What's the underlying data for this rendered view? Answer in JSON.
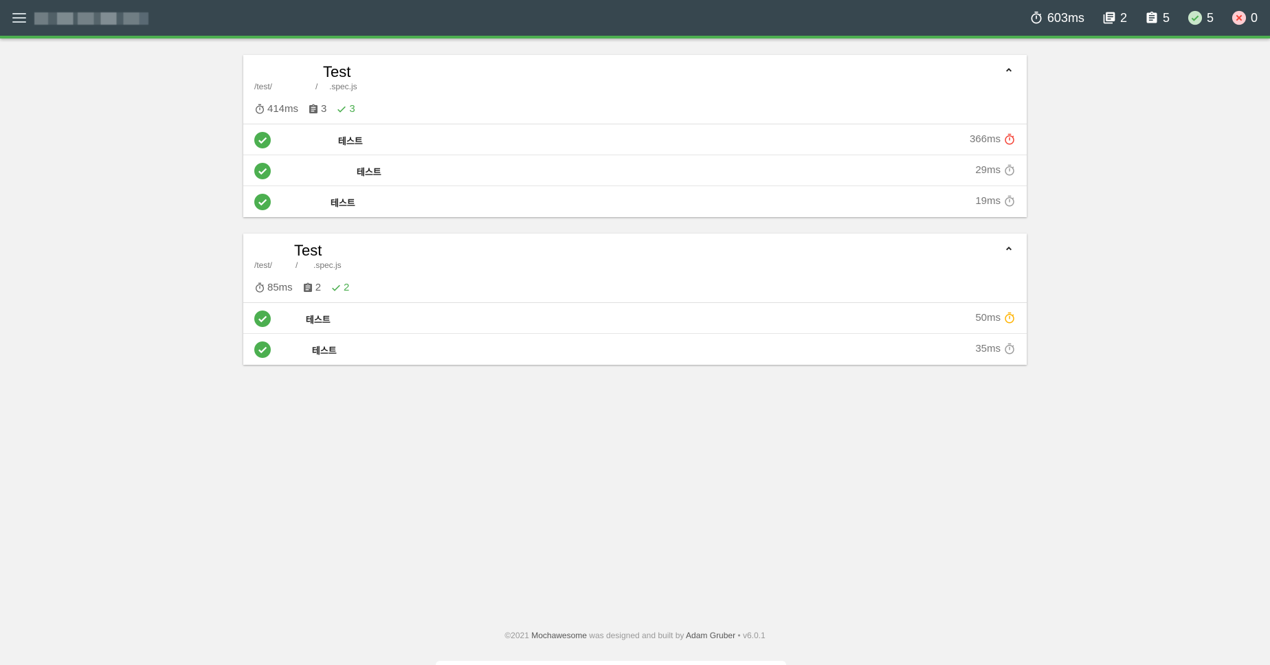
{
  "navbar": {
    "stats": {
      "duration": "603ms",
      "suites": "2",
      "tests": "5",
      "passes": "5",
      "failures": "0"
    }
  },
  "suites": [
    {
      "title": "Test",
      "path_prefix": "/test/",
      "path_sep": "/",
      "path_file": ".spec.js",
      "duration": "414ms",
      "tests_count": "3",
      "passes_count": "3",
      "tests": [
        {
          "title": "테스트",
          "duration": "366ms",
          "speed": "slow"
        },
        {
          "title": "테스트",
          "duration": "29ms",
          "speed": "fast"
        },
        {
          "title": "테스트",
          "duration": "19ms",
          "speed": "fast"
        }
      ]
    },
    {
      "title": "Test",
      "path_prefix": "/test/",
      "path_sep": "/",
      "path_file": ".spec.js",
      "duration": "85ms",
      "tests_count": "2",
      "passes_count": "2",
      "tests": [
        {
          "title": "테스트",
          "duration": "50ms",
          "speed": "medium"
        },
        {
          "title": "테스트",
          "duration": "35ms",
          "speed": "fast"
        }
      ]
    }
  ],
  "footer": {
    "copyright": "©2021",
    "brand": "Mochawesome",
    "text_mid": "was designed and built by",
    "author": "Adam Gruber",
    "version": "• v6.0.1"
  },
  "colors": {
    "navbar_bg": "#37474f",
    "accent_green": "#4caf50",
    "fail_red": "#f44336",
    "slow_red": "#f44336",
    "medium_amber": "#ffb300",
    "fast_gray": "#9e9e9e"
  },
  "icons": {
    "menu": "menu-icon",
    "timer": "timer-icon",
    "suites": "library-books-icon",
    "tests": "assignment-icon",
    "pass": "check-circle-icon",
    "fail": "cancel-circle-icon",
    "collapse": "chevron-up-icon"
  }
}
